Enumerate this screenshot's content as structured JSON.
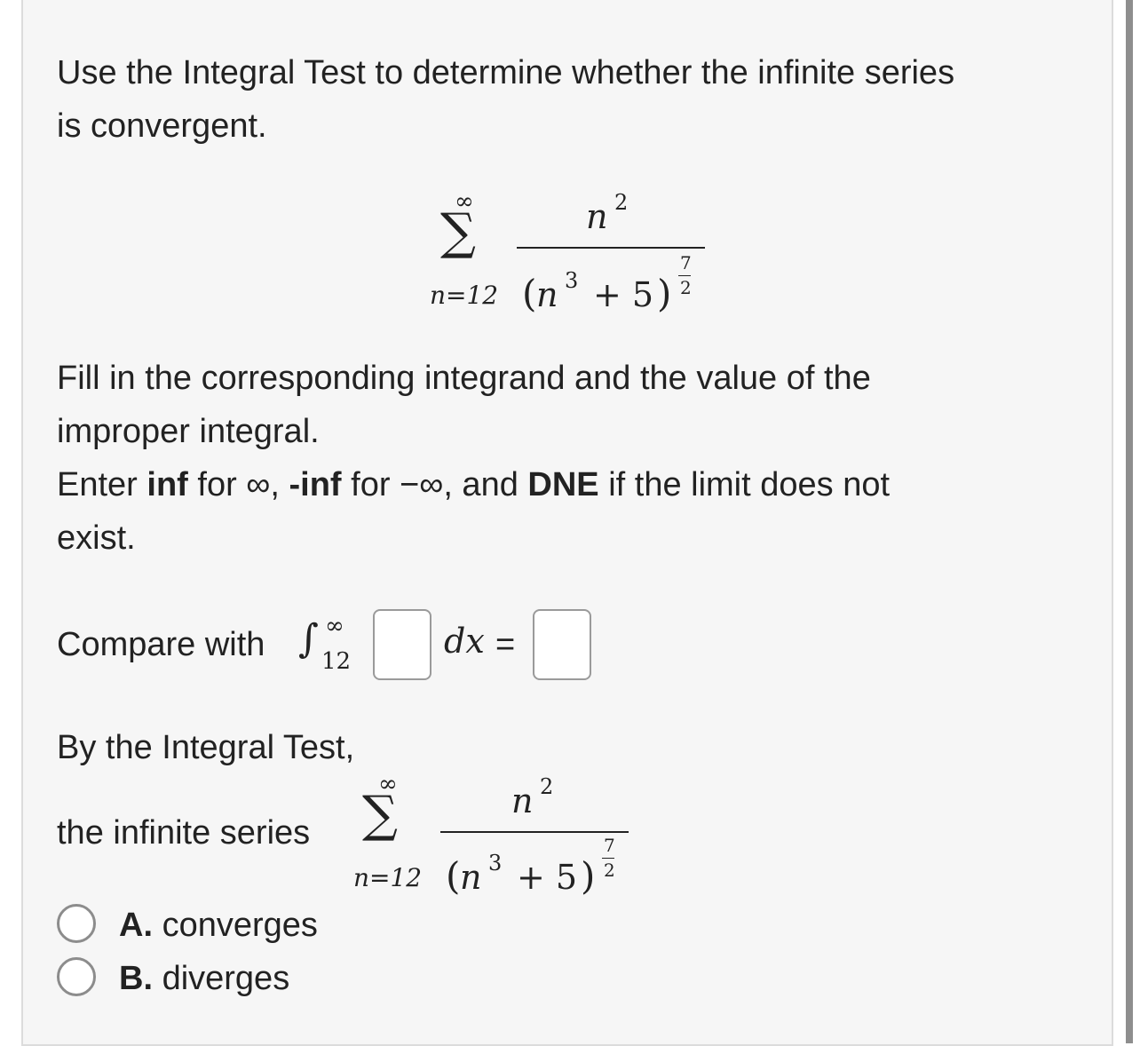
{
  "question": {
    "line1": "Use the Integral Test to determine whether the infinite series",
    "line2": "is convergent."
  },
  "series": {
    "sum_upper": "∞",
    "sum_lower": "n=12",
    "numerator_base": "n",
    "numerator_exp": "2",
    "denominator_base": "n",
    "denominator_base_exp": "3",
    "denominator_plus": "+ 5",
    "denominator_exp_num": "7",
    "denominator_exp_den": "2"
  },
  "instructions": {
    "line1": "Fill in the corresponding integrand and the value of the",
    "line2": "improper integral.",
    "enter_prefix": "Enter ",
    "inf_kw": "inf",
    "for1": " for ∞, ",
    "neg_inf_kw": "-inf",
    "for2": " for −∞, and ",
    "dne_kw": "DNE",
    "suffix": " if the limit does not",
    "line4": "exist."
  },
  "compare": {
    "label": "Compare with",
    "integral_upper": "∞",
    "integral_lower": "12",
    "dx": "dx",
    "equals": "=",
    "integrand_value": "",
    "integral_value": ""
  },
  "conclusion": {
    "intro": "By the Integral Test,",
    "series_label": "the infinite series"
  },
  "options": [
    {
      "letter": "A.",
      "text": "converges"
    },
    {
      "letter": "B.",
      "text": "diverges"
    }
  ]
}
